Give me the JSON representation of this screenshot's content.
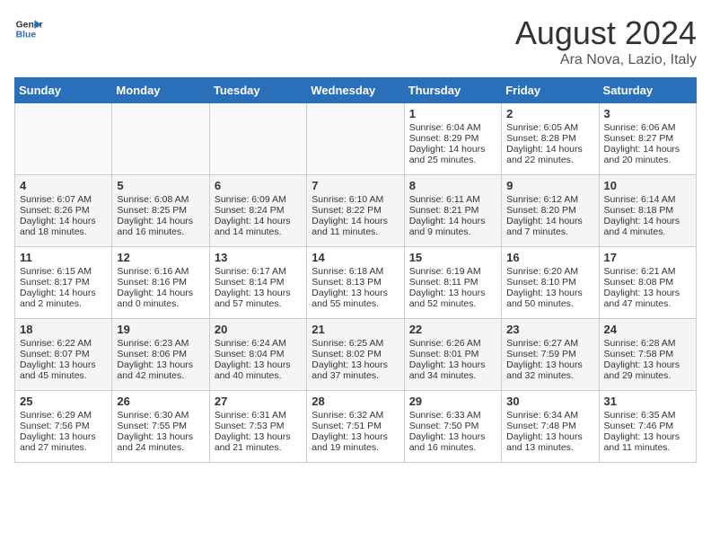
{
  "header": {
    "logo_line1": "General",
    "logo_line2": "Blue",
    "month": "August 2024",
    "location": "Ara Nova, Lazio, Italy"
  },
  "days_of_week": [
    "Sunday",
    "Monday",
    "Tuesday",
    "Wednesday",
    "Thursday",
    "Friday",
    "Saturday"
  ],
  "weeks": [
    [
      {
        "day": "",
        "info": ""
      },
      {
        "day": "",
        "info": ""
      },
      {
        "day": "",
        "info": ""
      },
      {
        "day": "",
        "info": ""
      },
      {
        "day": "1",
        "info": "Sunrise: 6:04 AM\nSunset: 8:29 PM\nDaylight: 14 hours and 25 minutes."
      },
      {
        "day": "2",
        "info": "Sunrise: 6:05 AM\nSunset: 8:28 PM\nDaylight: 14 hours and 22 minutes."
      },
      {
        "day": "3",
        "info": "Sunrise: 6:06 AM\nSunset: 8:27 PM\nDaylight: 14 hours and 20 minutes."
      }
    ],
    [
      {
        "day": "4",
        "info": "Sunrise: 6:07 AM\nSunset: 8:26 PM\nDaylight: 14 hours and 18 minutes."
      },
      {
        "day": "5",
        "info": "Sunrise: 6:08 AM\nSunset: 8:25 PM\nDaylight: 14 hours and 16 minutes."
      },
      {
        "day": "6",
        "info": "Sunrise: 6:09 AM\nSunset: 8:24 PM\nDaylight: 14 hours and 14 minutes."
      },
      {
        "day": "7",
        "info": "Sunrise: 6:10 AM\nSunset: 8:22 PM\nDaylight: 14 hours and 11 minutes."
      },
      {
        "day": "8",
        "info": "Sunrise: 6:11 AM\nSunset: 8:21 PM\nDaylight: 14 hours and 9 minutes."
      },
      {
        "day": "9",
        "info": "Sunrise: 6:12 AM\nSunset: 8:20 PM\nDaylight: 14 hours and 7 minutes."
      },
      {
        "day": "10",
        "info": "Sunrise: 6:14 AM\nSunset: 8:18 PM\nDaylight: 14 hours and 4 minutes."
      }
    ],
    [
      {
        "day": "11",
        "info": "Sunrise: 6:15 AM\nSunset: 8:17 PM\nDaylight: 14 hours and 2 minutes."
      },
      {
        "day": "12",
        "info": "Sunrise: 6:16 AM\nSunset: 8:16 PM\nDaylight: 14 hours and 0 minutes."
      },
      {
        "day": "13",
        "info": "Sunrise: 6:17 AM\nSunset: 8:14 PM\nDaylight: 13 hours and 57 minutes."
      },
      {
        "day": "14",
        "info": "Sunrise: 6:18 AM\nSunset: 8:13 PM\nDaylight: 13 hours and 55 minutes."
      },
      {
        "day": "15",
        "info": "Sunrise: 6:19 AM\nSunset: 8:11 PM\nDaylight: 13 hours and 52 minutes."
      },
      {
        "day": "16",
        "info": "Sunrise: 6:20 AM\nSunset: 8:10 PM\nDaylight: 13 hours and 50 minutes."
      },
      {
        "day": "17",
        "info": "Sunrise: 6:21 AM\nSunset: 8:08 PM\nDaylight: 13 hours and 47 minutes."
      }
    ],
    [
      {
        "day": "18",
        "info": "Sunrise: 6:22 AM\nSunset: 8:07 PM\nDaylight: 13 hours and 45 minutes."
      },
      {
        "day": "19",
        "info": "Sunrise: 6:23 AM\nSunset: 8:06 PM\nDaylight: 13 hours and 42 minutes."
      },
      {
        "day": "20",
        "info": "Sunrise: 6:24 AM\nSunset: 8:04 PM\nDaylight: 13 hours and 40 minutes."
      },
      {
        "day": "21",
        "info": "Sunrise: 6:25 AM\nSunset: 8:02 PM\nDaylight: 13 hours and 37 minutes."
      },
      {
        "day": "22",
        "info": "Sunrise: 6:26 AM\nSunset: 8:01 PM\nDaylight: 13 hours and 34 minutes."
      },
      {
        "day": "23",
        "info": "Sunrise: 6:27 AM\nSunset: 7:59 PM\nDaylight: 13 hours and 32 minutes."
      },
      {
        "day": "24",
        "info": "Sunrise: 6:28 AM\nSunset: 7:58 PM\nDaylight: 13 hours and 29 minutes."
      }
    ],
    [
      {
        "day": "25",
        "info": "Sunrise: 6:29 AM\nSunset: 7:56 PM\nDaylight: 13 hours and 27 minutes."
      },
      {
        "day": "26",
        "info": "Sunrise: 6:30 AM\nSunset: 7:55 PM\nDaylight: 13 hours and 24 minutes."
      },
      {
        "day": "27",
        "info": "Sunrise: 6:31 AM\nSunset: 7:53 PM\nDaylight: 13 hours and 21 minutes."
      },
      {
        "day": "28",
        "info": "Sunrise: 6:32 AM\nSunset: 7:51 PM\nDaylight: 13 hours and 19 minutes."
      },
      {
        "day": "29",
        "info": "Sunrise: 6:33 AM\nSunset: 7:50 PM\nDaylight: 13 hours and 16 minutes."
      },
      {
        "day": "30",
        "info": "Sunrise: 6:34 AM\nSunset: 7:48 PM\nDaylight: 13 hours and 13 minutes."
      },
      {
        "day": "31",
        "info": "Sunrise: 6:35 AM\nSunset: 7:46 PM\nDaylight: 13 hours and 11 minutes."
      }
    ]
  ]
}
